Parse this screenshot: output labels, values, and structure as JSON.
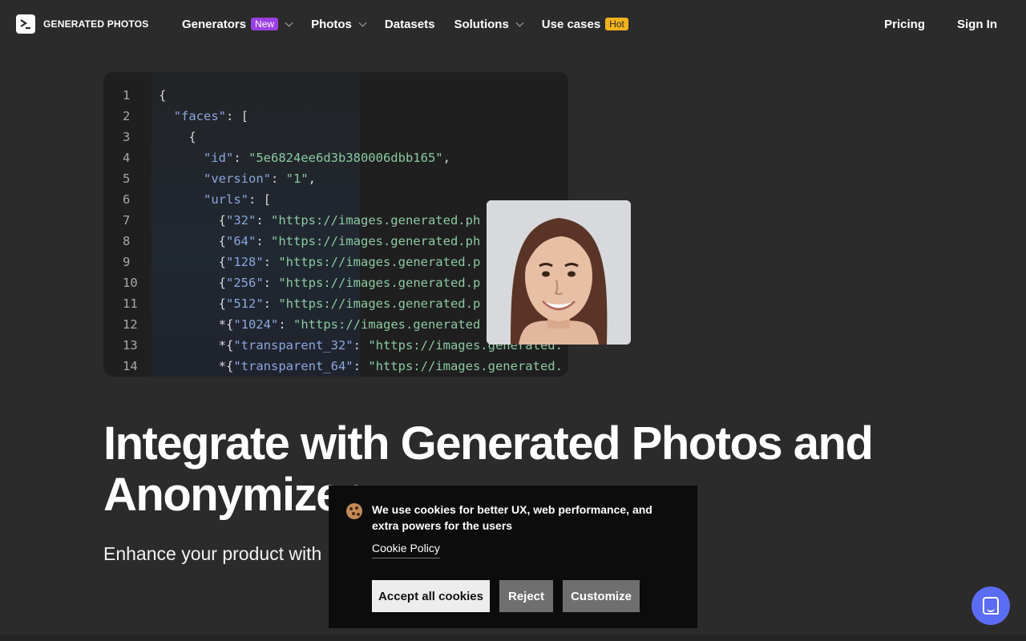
{
  "nav": {
    "brand": "GENERATED PHOTOS",
    "items": [
      {
        "label": "Generators",
        "badge": "New",
        "dropdown": true
      },
      {
        "label": "Photos",
        "badge": "",
        "dropdown": true
      },
      {
        "label": "Datasets",
        "badge": "",
        "dropdown": false
      },
      {
        "label": "Solutions",
        "badge": "",
        "dropdown": true
      },
      {
        "label": "Use cases",
        "badge": "Hot",
        "dropdown": false
      }
    ],
    "pricing": "Pricing",
    "signin": "Sign In"
  },
  "code": {
    "lines": [
      {
        "n": "1",
        "indent": "",
        "prefix": "",
        "key": "",
        "value": "",
        "text": "{"
      },
      {
        "n": "2",
        "indent": "  ",
        "key": "\"faces\"",
        "rest": ": ["
      },
      {
        "n": "3",
        "indent": "    ",
        "text": "{"
      },
      {
        "n": "4",
        "indent": "      ",
        "key": "\"id\"",
        "rest": ": ",
        "value": "\"5e6824ee6d3b380006dbb165\"",
        "tail": ","
      },
      {
        "n": "5",
        "indent": "      ",
        "key": "\"version\"",
        "rest": ": ",
        "value": "\"1\"",
        "tail": ","
      },
      {
        "n": "6",
        "indent": "      ",
        "key": "\"urls\"",
        "rest": ": ["
      },
      {
        "n": "7",
        "indent": "        ",
        "prefix": "{",
        "key": "\"32\"",
        "rest": ": ",
        "value": "\"https://images.generated.ph"
      },
      {
        "n": "8",
        "indent": "        ",
        "prefix": "{",
        "key": "\"64\"",
        "rest": ": ",
        "value": "\"https://images.generated.ph"
      },
      {
        "n": "9",
        "indent": "        ",
        "prefix": "{",
        "key": "\"128\"",
        "rest": ": ",
        "value": "\"https://images.generated.p"
      },
      {
        "n": "10",
        "indent": "        ",
        "prefix": "{",
        "key": "\"256\"",
        "rest": ": ",
        "value": "\"https://images.generated.p"
      },
      {
        "n": "11",
        "indent": "        ",
        "prefix": "{",
        "key": "\"512\"",
        "rest": ": ",
        "value": "\"https://images.generated.p"
      },
      {
        "n": "12",
        "indent": "        ",
        "prefix": "*{",
        "key": "\"1024\"",
        "rest": ": ",
        "value": "\"https://images.generated"
      },
      {
        "n": "13",
        "indent": "        ",
        "prefix": "*{",
        "key": "\"transparent_32\"",
        "rest": ": ",
        "value": "\"https://images.generated."
      },
      {
        "n": "14",
        "indent": "        ",
        "prefix": "*{",
        "key": "\"transparent_64\"",
        "rest": ": ",
        "value": "\"https://images.generated."
      }
    ]
  },
  "hero": {
    "title": "Integrate with Generated Photos and Anonymizer",
    "subtitle": "Enhance your product with"
  },
  "cookie": {
    "text": "We use cookies for better UX, web performance, and extra powers for the users",
    "policy": "Cookie Policy",
    "accept": "Accept all cookies",
    "reject": "Reject",
    "customize": "Customize"
  },
  "colors": {
    "background": "#2b2b2b",
    "badge_new": "#9c3fe2",
    "badge_hot": "#f2b21b",
    "chat": "#5b6cf5",
    "code_key": "#8ca6dc",
    "code_string": "#8cc9a0"
  }
}
